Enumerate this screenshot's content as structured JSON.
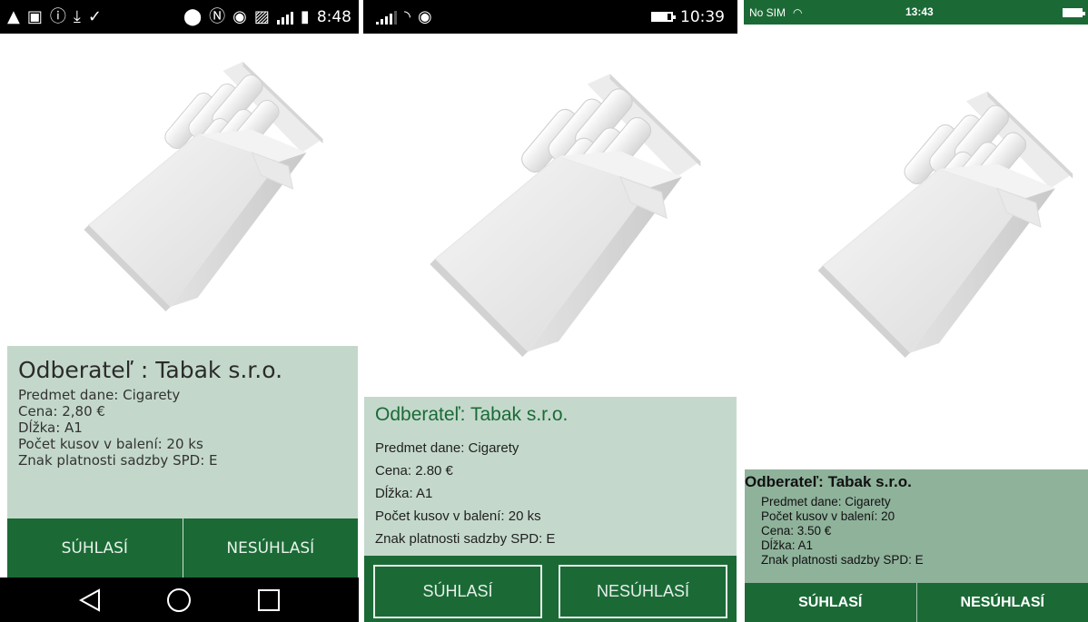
{
  "screens": [
    {
      "status": {
        "time": "8:48"
      },
      "info": {
        "title": "Odberateľ : Tabak s.r.o.",
        "lines": [
          "Predmet dane: Cigarety",
          "Cena: 2,80 €",
          "Dĺžka: A1",
          "Počet kusov v balení: 20 ks",
          "Znak platnosti sadzby SPD: E"
        ]
      },
      "buttons": {
        "agree": "SÚHLASÍ",
        "disagree": "NESÚHLASÍ"
      },
      "nav": {
        "back_icon": "back-triangle-icon",
        "home_icon": "home-circle-icon",
        "recents_icon": "recents-square-icon"
      }
    },
    {
      "status": {
        "time": "10:39"
      },
      "info": {
        "title": "Odberateľ: Tabak s.r.o.",
        "lines": [
          "Predmet dane: Cigarety",
          "Cena: 2.80 €",
          "Dĺžka: A1",
          "Počet kusov v balení: 20 ks",
          "Znak platnosti sadzby SPD: E"
        ]
      },
      "buttons": {
        "agree": "SÚHLASÍ",
        "disagree": "NESÚHLASÍ"
      }
    },
    {
      "status": {
        "carrier": "No SIM",
        "time": "13:43"
      },
      "info": {
        "title": "Odberateľ: Tabak s.r.o.",
        "lines": [
          "Predmet dane: Cigarety",
          "Počet kusov v balení: 20",
          "Cena: 3.50 €",
          "Dĺžka: A1",
          "Znak platnosti sadzby SPD: E"
        ]
      },
      "buttons": {
        "agree": "SÚHLASÍ",
        "disagree": "NESÚHLASÍ"
      }
    }
  ],
  "colors": {
    "accent": "#1b6a36",
    "panel": "#c3d8cb",
    "panel_ios": "#8fb29b"
  }
}
